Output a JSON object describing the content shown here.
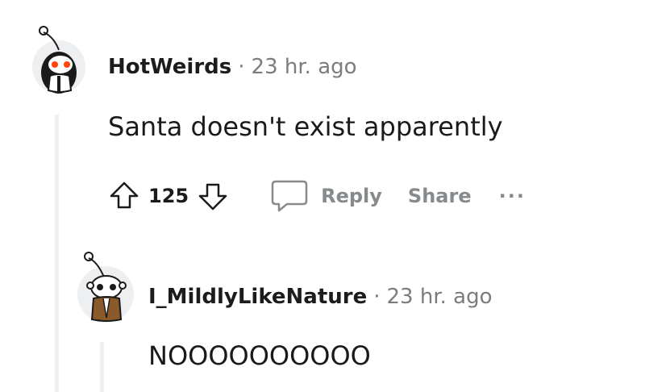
{
  "comment": {
    "username": "HotWeirds",
    "separator": "·",
    "time": "23 hr. ago",
    "body": "Santa doesn't exist apparently",
    "score": "125",
    "actions": {
      "reply_label": "Reply",
      "share_label": "Share",
      "more_label": "···"
    },
    "icons": {
      "upvote": "arrow-up-icon",
      "downvote": "arrow-down-icon",
      "reply": "speech-bubble-icon",
      "avatar": "snoo-avatar-icon"
    }
  },
  "reply": {
    "username": "I_MildlyLikeNature",
    "separator": "·",
    "time": "23 hr. ago",
    "body": "NOOOOOOOOOO",
    "icons": {
      "avatar": "snoo-avatar-icon"
    }
  },
  "colors": {
    "text": "#1a1a1b",
    "meta": "#7c7c7c",
    "action": "#878a8c",
    "thread_line": "#edeff1",
    "avatar_bg": "#edeff1",
    "snoo_eye": "#ff4500"
  }
}
